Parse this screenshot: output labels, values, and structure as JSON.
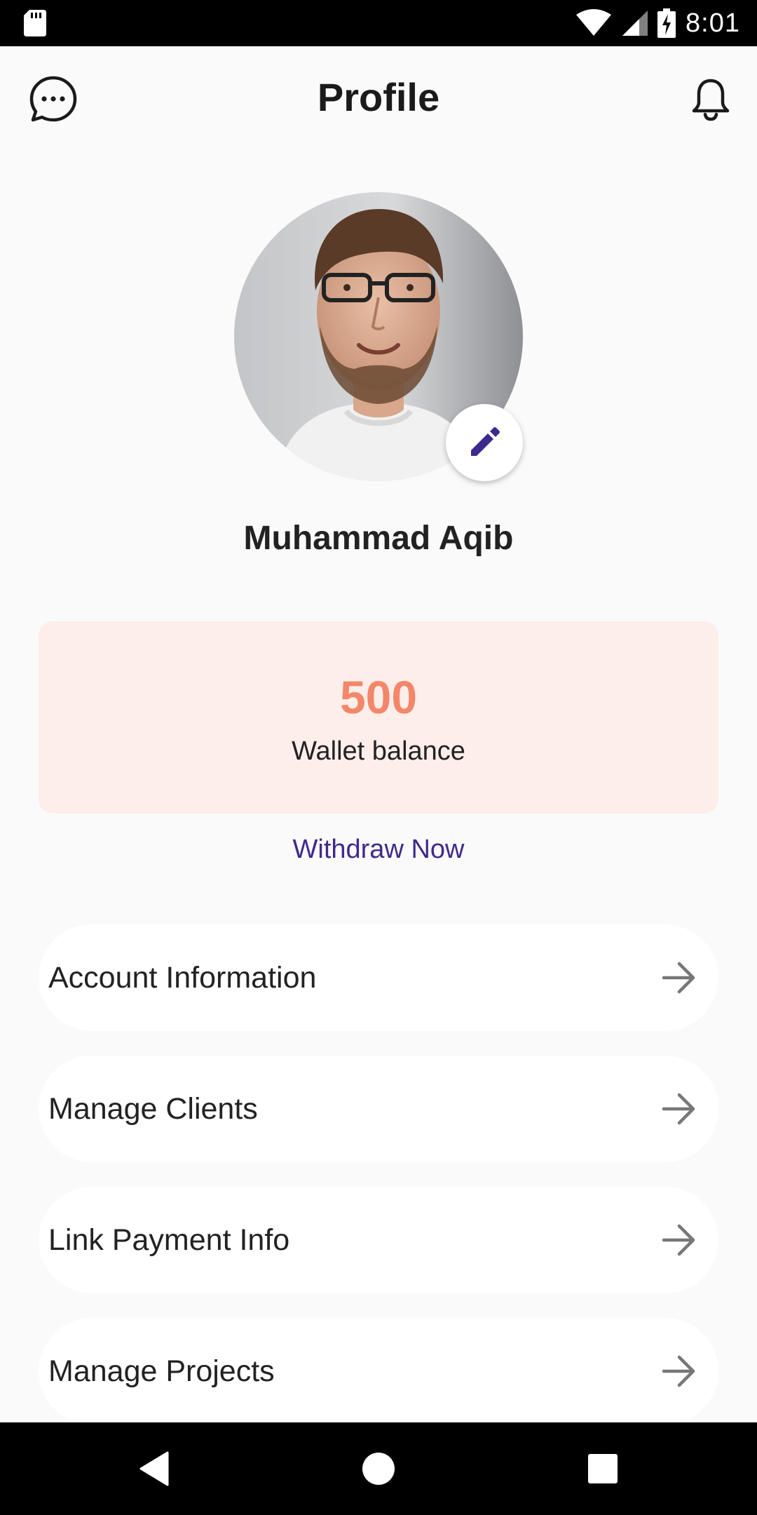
{
  "status_bar": {
    "time": "8:01",
    "icons": [
      "sd-card-icon",
      "wifi-icon",
      "cell-signal-icon",
      "battery-charging-icon"
    ]
  },
  "header": {
    "title": "Profile",
    "left_icon": "chat-bubble-icon",
    "right_icon": "bell-icon"
  },
  "profile": {
    "name": "Muhammad Aqib",
    "edit_icon": "pencil-icon"
  },
  "wallet": {
    "amount": "500",
    "label": "Wallet balance",
    "withdraw_label": "Withdraw Now"
  },
  "menu": {
    "items": [
      {
        "label": "Account Information",
        "icon": "arrow-right-icon"
      },
      {
        "label": "Manage Clients",
        "icon": "arrow-right-icon"
      },
      {
        "label": "Link Payment Info",
        "icon": "arrow-right-icon"
      },
      {
        "label": "Manage Projects",
        "icon": "arrow-right-icon"
      }
    ]
  },
  "nav_bar": {
    "icons": [
      "back-icon",
      "home-icon",
      "recents-icon"
    ]
  },
  "colors": {
    "wallet_bg": "#fdeee9",
    "wallet_amount": "#f4866a",
    "accent_purple": "#3f2a8c",
    "background": "#fafafa"
  }
}
